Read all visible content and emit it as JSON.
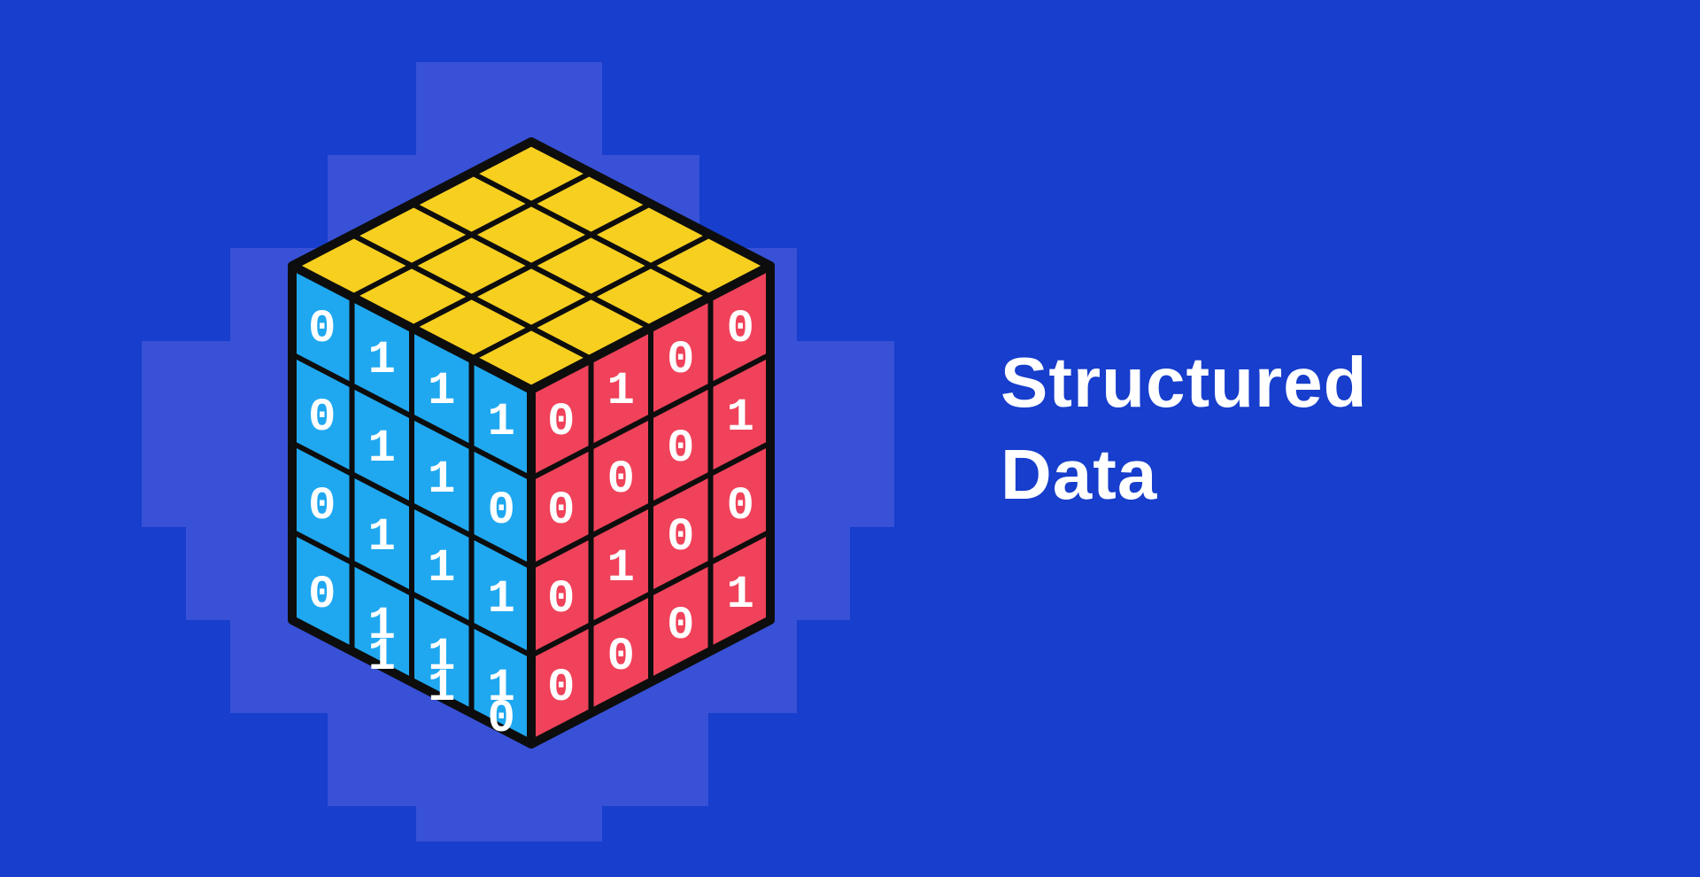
{
  "title": {
    "line1": "Structured",
    "line2": "Data"
  },
  "colors": {
    "background": "#173ecc",
    "pixel_glow": "#3851d6",
    "cube_top": "#f7cf1f",
    "cube_left": "#1fa8f0",
    "cube_right": "#f0425a",
    "stroke": "#0d0d0d",
    "digit": "#ffffff"
  },
  "cube": {
    "left_face": {
      "rows": [
        [
          "0",
          "1",
          "",
          ""
        ],
        [
          "0",
          "1",
          "1",
          ""
        ],
        [
          "0",
          "1",
          "1",
          "1"
        ],
        [
          "0",
          "1",
          "1",
          "0"
        ],
        [
          "",
          "1",
          "1",
          "1"
        ],
        [
          "",
          "",
          "1",
          "1"
        ],
        [
          "",
          "",
          "",
          "0"
        ]
      ]
    },
    "right_face": {
      "rows": [
        [
          "0",
          "1",
          "0",
          "0"
        ],
        [
          "0",
          "0",
          "0",
          "1"
        ],
        [
          "0",
          "1",
          "0",
          "0"
        ],
        [
          "0",
          "0",
          "0",
          "1"
        ]
      ]
    }
  }
}
